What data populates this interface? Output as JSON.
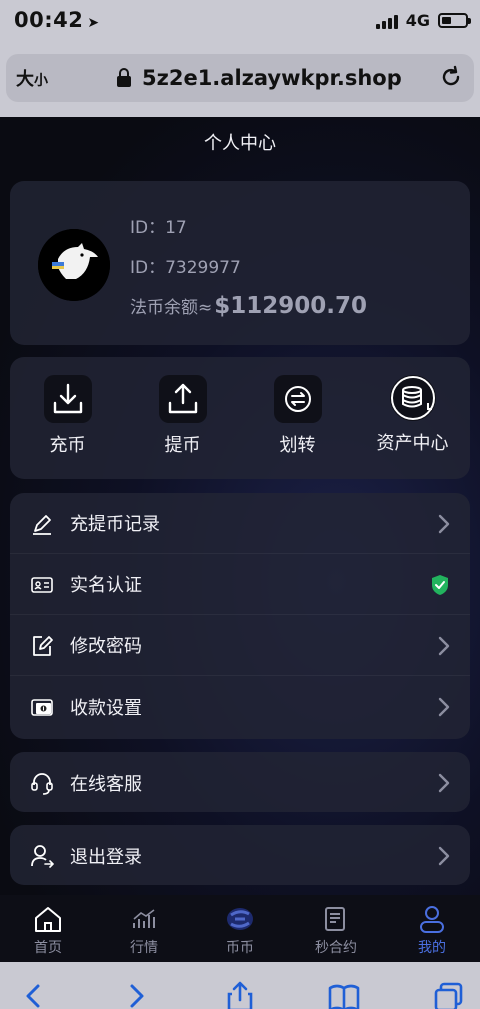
{
  "status_bar": {
    "time": "00:42",
    "location_glyph": "➤",
    "network": "4G",
    "battery_level": 0.4
  },
  "browser": {
    "text_size_label": "大",
    "text_size_small": "小",
    "url": "5z2e1.alzaywkpr.shop"
  },
  "page": {
    "title": "个人中心"
  },
  "profile": {
    "id_line_1": "ID：17",
    "id_line_2": "ID：7329977",
    "balance_label": "法币余额≈",
    "balance_value": "$112900.70"
  },
  "actions": [
    {
      "label": "充币",
      "icon": "deposit-icon"
    },
    {
      "label": "提币",
      "icon": "withdraw-icon"
    },
    {
      "label": "划转",
      "icon": "transfer-icon"
    },
    {
      "label": "资产中心",
      "icon": "assets-icon"
    }
  ],
  "menu": [
    {
      "label": "充提币记录",
      "icon": "pen-icon",
      "trailing": "chevron"
    },
    {
      "label": "实名认证",
      "icon": "id-card-icon",
      "trailing": "verified-check"
    },
    {
      "label": "修改密码",
      "icon": "edit-icon",
      "trailing": "chevron"
    },
    {
      "label": "收款设置",
      "icon": "wallet-icon",
      "trailing": "chevron"
    }
  ],
  "service": {
    "label": "在线客服",
    "icon": "headset-icon"
  },
  "logout": {
    "label": "退出登录",
    "icon": "user-logout-icon"
  },
  "tabs": [
    {
      "label": "首页",
      "icon": "home-icon",
      "active": false
    },
    {
      "label": "行情",
      "icon": "chart-icon",
      "active": false
    },
    {
      "label": "币币",
      "icon": "coin-swap-icon",
      "active": false
    },
    {
      "label": "秒合约",
      "icon": "contract-icon",
      "active": false
    },
    {
      "label": "我的",
      "icon": "profile-icon",
      "active": true
    }
  ],
  "colors": {
    "accent": "#4a6fe0",
    "verified": "#22b35e"
  }
}
